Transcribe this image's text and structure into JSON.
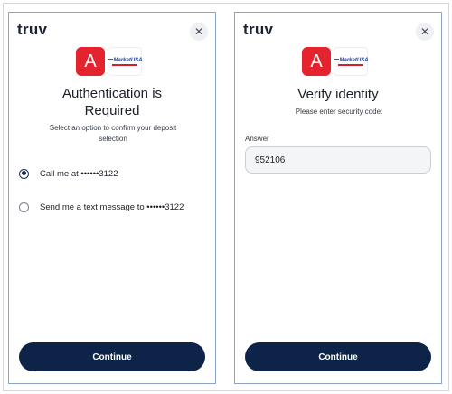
{
  "left_panel": {
    "brand": "truv",
    "close_glyph": "✕",
    "logo_letter": "A",
    "partner_logo_text": "MarketUSA",
    "title_line1": "Authentication is",
    "title_line2": "Required",
    "subtitle_line1": "Select an option to confirm your deposit",
    "subtitle_line2": "selection",
    "options": [
      {
        "label": "Call me at ••••••3122",
        "selected": true
      },
      {
        "label": "Send me a text message to ••••••3122",
        "selected": false
      }
    ],
    "continue_label": "Continue"
  },
  "right_panel": {
    "brand": "truv",
    "close_glyph": "✕",
    "logo_letter": "A",
    "partner_logo_text": "MarketUSA",
    "title": "Verify identity",
    "subtitle": "Please enter security code:",
    "field_label": "Answer",
    "field_value": "952106",
    "continue_label": "Continue"
  },
  "colors": {
    "primary_button": "#0d2448",
    "logo_red": "#e4232e",
    "panel_border": "#8ea3c8"
  }
}
